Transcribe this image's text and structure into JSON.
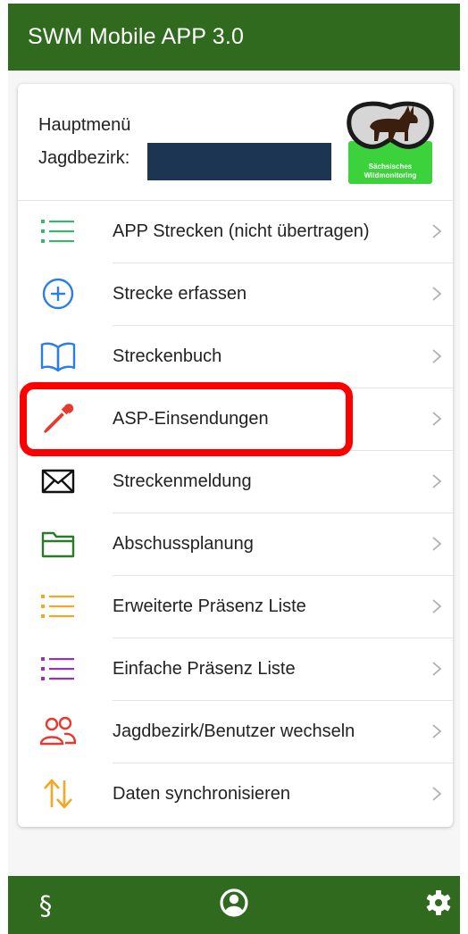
{
  "app": {
    "title": "SWM Mobile APP 3.0"
  },
  "header": {
    "main_menu_label": "Hauptmenü",
    "hunting_district_label": "Jagdbezirk:",
    "logo_text": [
      "Sächsisches",
      "Wildmonitoring"
    ]
  },
  "menu": {
    "items": [
      {
        "label": "APP Strecken (nicht übertragen)",
        "icon": "list-icon",
        "color": "#3cb46e"
      },
      {
        "label": "Strecke erfassen",
        "icon": "add-circle-icon",
        "color": "#2b7de9"
      },
      {
        "label": "Streckenbuch",
        "icon": "book-icon",
        "color": "#2b7de9"
      },
      {
        "label": "ASP-Einsendungen",
        "icon": "pipette-icon",
        "color": "#e8392f"
      },
      {
        "label": "Streckenmeldung",
        "icon": "mail-icon",
        "color": "#111111"
      },
      {
        "label": "Abschussplanung",
        "icon": "folder-icon",
        "color": "#2a7a2a"
      },
      {
        "label": "Erweiterte Präsenz Liste",
        "icon": "list-icon",
        "color": "#f5a623"
      },
      {
        "label": "Einfache Präsenz Liste",
        "icon": "list-icon",
        "color": "#9b2fb5"
      },
      {
        "label": "Jagdbezirk/Benutzer wechseln",
        "icon": "users-icon",
        "color": "#e8392f"
      },
      {
        "label": "Daten synchronisieren",
        "icon": "sync-arrows-icon",
        "color": "#f5a623"
      }
    ],
    "highlighted_index": 3
  },
  "bottom_bar": {
    "paragraph_symbol": "§",
    "items": [
      "paragraph-icon",
      "user-circle-icon",
      "gear-icon"
    ]
  },
  "colors": {
    "brand_green": "#2f6a1f",
    "highlight_red": "#ff0000",
    "redacted_field": "#1b3553"
  }
}
